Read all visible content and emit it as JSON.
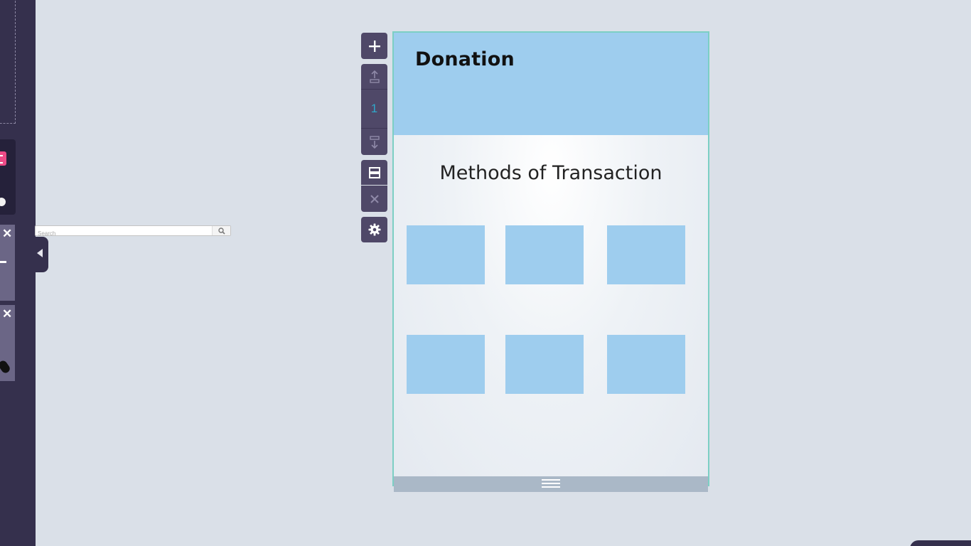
{
  "sidebar": {
    "card_close_symbol": "✕"
  },
  "search": {
    "placeholder": "Search"
  },
  "toolbar": {
    "add_icon": "plus-icon",
    "move_up_icon": "move-up-icon",
    "page_number": "1",
    "move_down_icon": "move-down-icon",
    "layout_icon": "layout-icon",
    "delete_icon": "close-icon",
    "settings_icon": "gear-icon"
  },
  "page": {
    "title": "Donation",
    "section_heading": "Methods of Transaction",
    "method_tiles": 6,
    "accent_color": "#9ecdee",
    "border_color": "#7ccfc4"
  },
  "colors": {
    "background": "#dae0e8",
    "sidebar": "#35304d",
    "toolbar": "#4f4868",
    "page_number": "#30a7c9"
  }
}
